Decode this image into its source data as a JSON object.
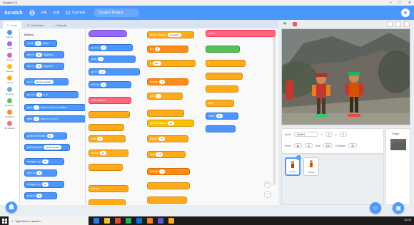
{
  "window": {
    "title": "Scratch 3.0",
    "controls": [
      "–",
      "□",
      "✕"
    ]
  },
  "menubar": {
    "logo": "Scratch",
    "items": [
      {
        "icon": "globe-icon",
        "label": ""
      },
      {
        "label": "File"
      },
      {
        "label": "Edit"
      },
      {
        "label": "Tutorials"
      }
    ],
    "project_title": "Scratch Project"
  },
  "tabs": [
    {
      "label": "Code",
      "icon": "code-icon",
      "active": true
    },
    {
      "label": "Costumes",
      "icon": "brush-icon",
      "active": false
    },
    {
      "label": "Sounds",
      "icon": "speaker-icon",
      "active": false
    }
  ],
  "categories": [
    {
      "label": "Motion",
      "color": "#4c97ff"
    },
    {
      "label": "Looks",
      "color": "#9966ff"
    },
    {
      "label": "Sound",
      "color": "#cf63cf"
    },
    {
      "label": "Events",
      "color": "#ffbf00"
    },
    {
      "label": "Control",
      "color": "#ffab19"
    },
    {
      "label": "Sensing",
      "color": "#5cb1d6"
    },
    {
      "label": "Operators",
      "color": "#59c059"
    },
    {
      "label": "Variables",
      "color": "#ff8c1a"
    },
    {
      "label": "My Blocks",
      "color": "#ff6680"
    }
  ],
  "palette": {
    "heading": "Motion",
    "blocks": [
      {
        "text": "move",
        "input": "10",
        "suffix": "steps"
      },
      {
        "text": "turn ↻",
        "input": "15",
        "suffix": "degrees"
      },
      {
        "text": "turn ↺",
        "input": "15",
        "suffix": "degrees"
      },
      {
        "text": "go to",
        "input": "random position",
        "suffix": ""
      },
      {
        "text": "go to x:",
        "input": "0",
        "suffix": "y: 0"
      },
      {
        "text": "glide",
        "input": "1",
        "suffix": "secs to random position"
      },
      {
        "text": "glide",
        "input": "1",
        "suffix": "secs to x: 0 y: 0"
      },
      {
        "text": "point in direction",
        "input": "90",
        "suffix": ""
      },
      {
        "text": "point towards",
        "input": "mouse-pointer",
        "suffix": ""
      },
      {
        "text": "change x by",
        "input": "10",
        "suffix": ""
      },
      {
        "text": "set x to",
        "input": "0",
        "suffix": ""
      },
      {
        "text": "change y by",
        "input": "10",
        "suffix": ""
      },
      {
        "text": "set y to",
        "input": "0",
        "suffix": ""
      }
    ]
  },
  "scripts": {
    "col1": [
      {
        "cat": "looks",
        "text": "",
        "hat": true
      },
      {
        "cat": "motion",
        "text": "go to x:",
        "input": "0"
      },
      {
        "cat": "motion",
        "text": "glide",
        "input": "1"
      },
      {
        "cat": "motion",
        "text": "go to",
        "input": "x y"
      },
      {
        "cat": "motion",
        "text": "set x to",
        "input": "0"
      },
      {
        "cat": "myblocks",
        "text": "when clicked",
        "input": ""
      },
      {
        "cat": "control",
        "text": "wait",
        "input": "1"
      },
      {
        "cat": "control",
        "text": "repeat",
        "input": "10"
      },
      {
        "cat": "control",
        "text": "forever",
        "input": ""
      }
    ],
    "col2": [
      {
        "cat": "control",
        "text": "when I receive",
        "input": "message1"
      },
      {
        "cat": "variables",
        "text": "set",
        "input": "0"
      },
      {
        "cat": "control",
        "text": "if",
        "input": "then"
      },
      {
        "cat": "variables",
        "text": "change",
        "input": "1"
      },
      {
        "cat": "control",
        "text": "wait",
        "input": "1"
      }
    ],
    "col3": [
      {
        "cat": "events",
        "text": "when I receive",
        "input": "go"
      },
      {
        "cat": "control",
        "text": "repeat",
        "input": "10"
      },
      {
        "cat": "control",
        "text": "wait",
        "input": "0.5"
      },
      {
        "cat": "variables",
        "text": "change",
        "input": "1"
      }
    ],
    "col4": [
      {
        "cat": "myblocks",
        "text": "define",
        "input": ""
      },
      {
        "cat": "operators",
        "text": "",
        "input": ""
      },
      {
        "cat": "control",
        "text": "if",
        "input": ""
      },
      {
        "cat": "control",
        "text": "wait",
        "input": ""
      },
      {
        "cat": "motion",
        "text": "move",
        "input": "10"
      }
    ]
  },
  "stage_header": {
    "flag": "⚑"
  },
  "sprite_info": {
    "sprite_label": "Sprite",
    "sprite_name": "Sprite1",
    "x_label": "x",
    "x_value": "0",
    "y_label": "y",
    "y_value": "0",
    "show_label": "Show",
    "size_label": "Size",
    "size_value": "100",
    "direction_label": "Direction",
    "direction_value": "90"
  },
  "sprites": [
    {
      "name": "Sprite1",
      "selected": true
    },
    {
      "name": "Sprite2",
      "selected": false
    }
  ],
  "backdrop_label": "Stage",
  "taskbar": {
    "search_placeholder": "Type here to search",
    "time": "12:00"
  }
}
